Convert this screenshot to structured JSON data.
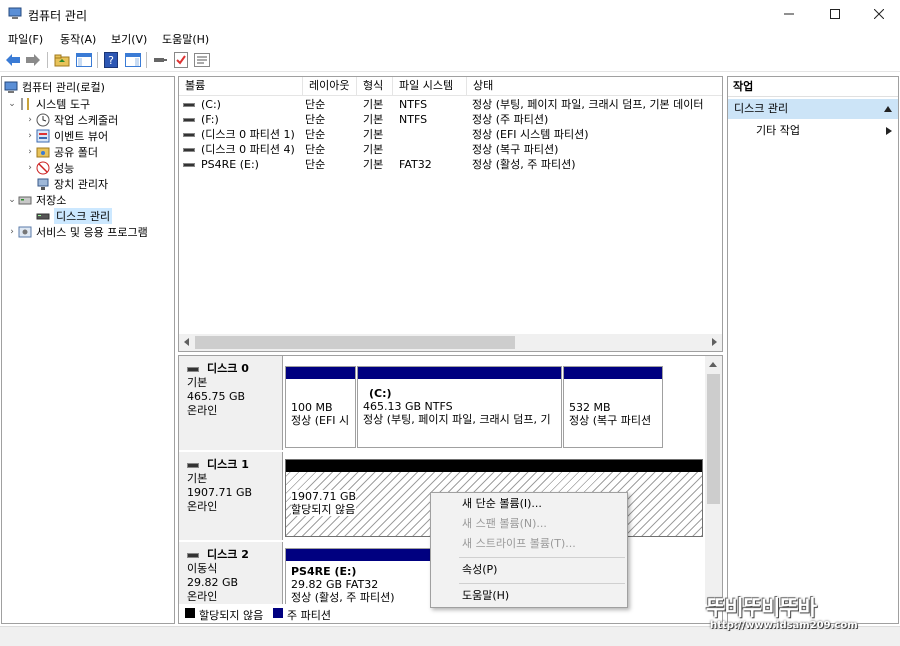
{
  "window": {
    "title": "컴퓨터 관리"
  },
  "menu": [
    "파일(F)",
    "동작(A)",
    "보기(V)",
    "도움말(H)"
  ],
  "tree": {
    "root": "컴퓨터 관리(로컬)",
    "system_tools": "시스템 도구",
    "task_scheduler": "작업 스케줄러",
    "event_viewer": "이벤트 뷰어",
    "shared_folders": "공유 폴더",
    "performance": "성능",
    "device_manager": "장치 관리자",
    "storage": "저장소",
    "disk_management": "디스크 관리",
    "services": "서비스 및 응용 프로그램"
  },
  "volumes": {
    "headers": [
      "볼륨",
      "레이아웃",
      "형식",
      "파일 시스템",
      "상태"
    ],
    "rows": [
      [
        "(C:)",
        "단순",
        "기본",
        "NTFS",
        "정상 (부팅, 페이지 파일, 크래시 덤프, 기본 데이터"
      ],
      [
        "(F:)",
        "단순",
        "기본",
        "NTFS",
        "정상 (주 파티션)"
      ],
      [
        "(디스크 0 파티션 1)",
        "단순",
        "기본",
        "",
        "정상 (EFI 시스템 파티션)"
      ],
      [
        "(디스크 0 파티션 4)",
        "단순",
        "기본",
        "",
        "정상 (복구 파티션)"
      ],
      [
        "PS4RE (E:)",
        "단순",
        "기본",
        "FAT32",
        "정상 (활성, 주 파티션)"
      ]
    ]
  },
  "disks": {
    "disk0": {
      "name": "디스크 0",
      "type": "기본",
      "size": "465.75 GB",
      "status": "온라인",
      "p1": {
        "size": "100 MB",
        "status": "정상 (EFI 시"
      },
      "p2": {
        "label": "(C:)",
        "size": "465.13 GB NTFS",
        "status": "정상 (부팅, 페이지 파일, 크래시 덤프, 기"
      },
      "p3": {
        "size": "532 MB",
        "status": "정상 (복구 파티션"
      }
    },
    "disk1": {
      "name": "디스크 1",
      "type": "기본",
      "size": "1907.71 GB",
      "status": "온라인",
      "p1": {
        "size": "1907.71 GB",
        "status": "할당되지 않음"
      }
    },
    "disk2": {
      "name": "디스크 2",
      "type": "이동식",
      "size": "29.82 GB",
      "status": "온라인",
      "p1": {
        "label": "PS4RE  (E:)",
        "size": "29.82 GB FAT32",
        "status": "정상 (활성, 주 파티션)"
      }
    }
  },
  "legend": {
    "unallocated": "할당되지 않음",
    "primary": "주 파티션"
  },
  "actions": {
    "header": "작업",
    "section": "디스크 관리",
    "more": "기타 작업"
  },
  "context_menu": {
    "new_simple": "새 단순 볼륨(I)...",
    "new_spanned": "새 스팬 볼륨(N)...",
    "new_striped": "새 스트라이프 볼륨(T)...",
    "properties": "속성(P)",
    "help": "도움말(H)"
  },
  "watermark": {
    "brand": "뚜비뚜비뚜바",
    "url": "http://www.idsam209.com"
  },
  "colors": {
    "primary_partition": "#000080",
    "unallocated": "#000000",
    "selection": "#cce8ff",
    "action_section": "#cce4f7"
  }
}
